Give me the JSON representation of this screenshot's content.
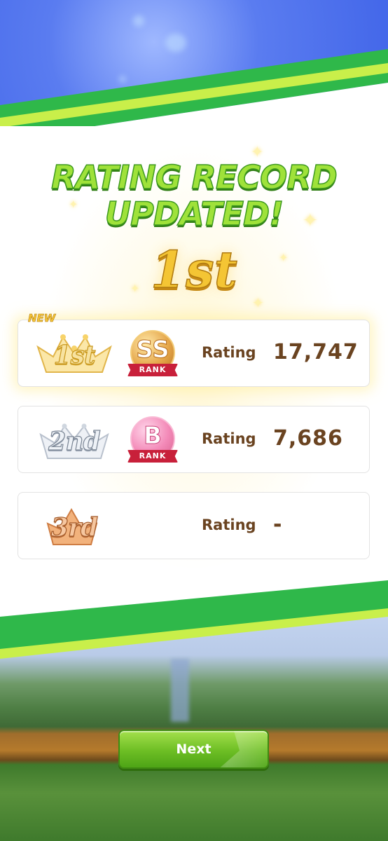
{
  "header": {
    "title_line1": "RATING RECORD",
    "title_line2": "UPDATED!",
    "current_place": "1st"
  },
  "records": [
    {
      "place": "1st",
      "is_new": true,
      "new_label": "NEW",
      "rank_letter": "SS",
      "rank_word": "RANK",
      "rating_label": "Rating",
      "rating_value": "17,747",
      "tier": "gold"
    },
    {
      "place": "2nd",
      "is_new": false,
      "rank_letter": "B",
      "rank_word": "RANK",
      "rating_label": "Rating",
      "rating_value": "7,686",
      "tier": "silver"
    },
    {
      "place": "3rd",
      "is_new": false,
      "rank_letter": "",
      "rank_word": "",
      "rating_label": "Rating",
      "rating_value": "-",
      "tier": "bronze"
    }
  ],
  "footer": {
    "next_label": "Next"
  },
  "colors": {
    "accent_green": "#6dbe24",
    "text_brown": "#6a4320",
    "gold": "#f4c534",
    "rank_ribbon": "#c8203a"
  }
}
